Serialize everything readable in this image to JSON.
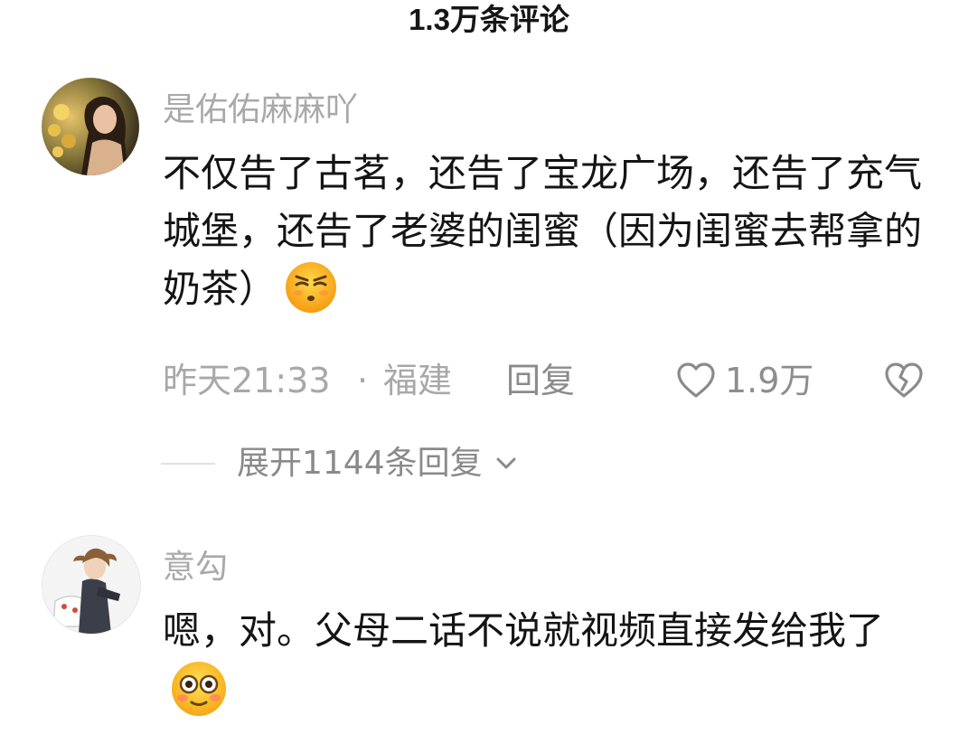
{
  "header": {
    "title": "1.3万条评论"
  },
  "comments": [
    {
      "username": "是佑佑麻麻吖",
      "text": "不仅告了古茗，还告了宝龙广场，还告了充气城堡，还告了老婆的闺蜜（因为闺蜜去帮拿的奶茶）",
      "emoji": "smirk-emoji-icon",
      "time": "昨天21:33",
      "separator": "·",
      "location": "福建",
      "reply_label": "回复",
      "like_count": "1.9万",
      "expand_label": "展开1144条回复"
    },
    {
      "username": "意勾",
      "text": "嗯，对。父母二话不说就视频直接发给我了",
      "emoji": "flushed-emoji-icon"
    }
  ],
  "colors": {
    "username": "#a9a9a9",
    "body_text": "#141414",
    "meta_text": "#a8a8a8",
    "emoji_yellow": "#ffc21a"
  }
}
